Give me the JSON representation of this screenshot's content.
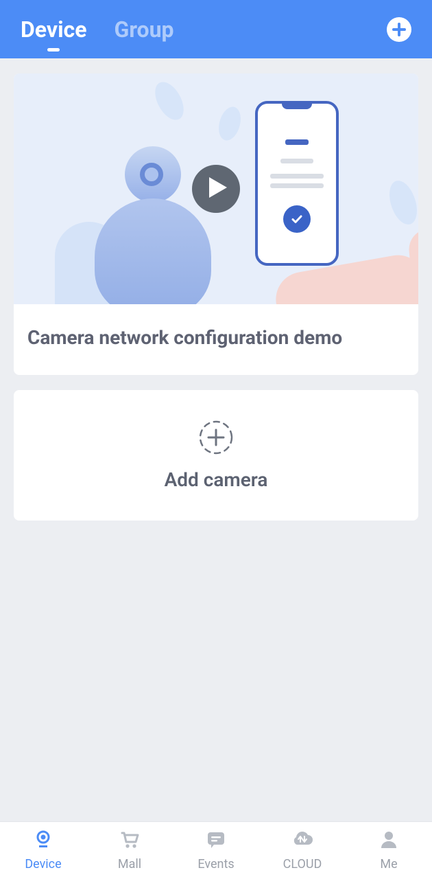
{
  "header": {
    "tabs": [
      {
        "label": "Device",
        "active": true
      },
      {
        "label": "Group",
        "active": false
      }
    ]
  },
  "demo": {
    "title": "Camera network configuration demo"
  },
  "add_camera": {
    "label": "Add camera"
  },
  "bottom_nav": [
    {
      "label": "Device",
      "icon": "camera-icon",
      "active": true
    },
    {
      "label": "Mall",
      "icon": "cart-icon",
      "active": false
    },
    {
      "label": "Events",
      "icon": "chat-icon",
      "active": false
    },
    {
      "label": "CLOUD",
      "icon": "cloud-icon",
      "active": false
    },
    {
      "label": "Me",
      "icon": "person-icon",
      "active": false
    }
  ],
  "colors": {
    "primary": "#4c8cf6",
    "active_indicator": "#ffffff",
    "muted": "#9ba0a9"
  }
}
